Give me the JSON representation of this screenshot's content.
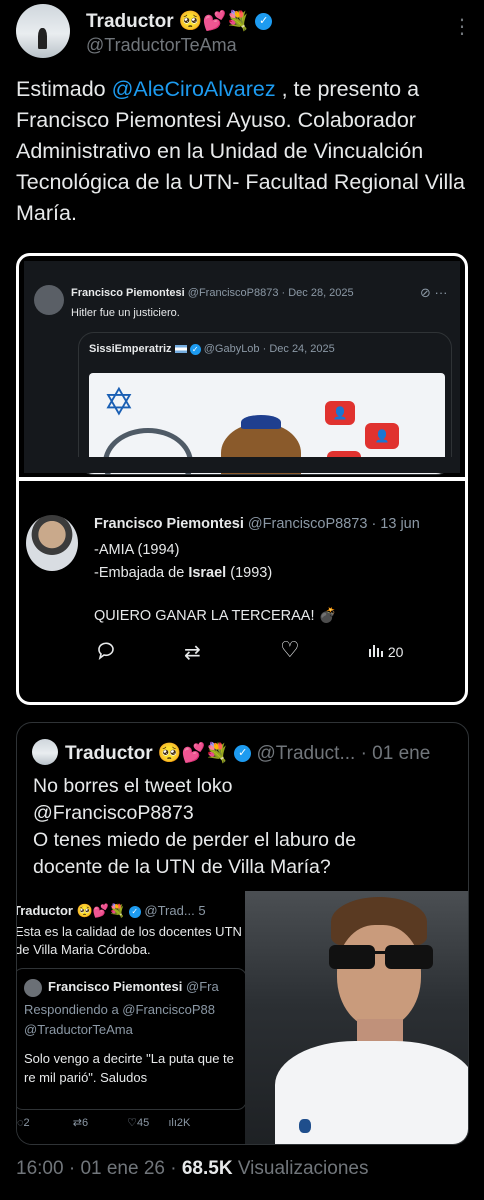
{
  "header": {
    "name": "Traductor",
    "name_emojis": "🥺💕💐",
    "handle": "@TraductorTeAma",
    "more": "⋮"
  },
  "tweet": {
    "text_pre": "Estimado ",
    "mention": "@AleCiroAlvarez",
    "text_post": " , te presento a Francisco Piemontesi Ayuso. Colaborador Administrativo en la Unidad de Vincualción Tecnológica de la UTN- Facultad Regional Villa María."
  },
  "shot1": {
    "name": "Francisco Piemontesi",
    "handle_date": "@FranciscoP8873 · Dec 28, 2025",
    "text": "Hitler fue un justiciero.",
    "quoted_name": "SissiEmperatriz",
    "quoted_handle_date": "@GabyLob · Dec 24, 2025",
    "star": "✡",
    "badge1": "👤",
    "badge2": "👤"
  },
  "shot2": {
    "name": "Francisco Piemontesi",
    "handle_date": "@FranciscoP8873 · 13 jun",
    "line1": "-AMIA (1994)",
    "line2_pre": "-Embajada de ",
    "line2_bold": "Israel",
    "line2_post": " (1993)",
    "line3": "QUIERO GANAR LA TERCERAA! 💣",
    "reply_icon": "💬",
    "retweet_icon": "⇄",
    "like_icon": "♡",
    "views": "20"
  },
  "quote": {
    "name": "Traductor",
    "name_emojis": "🥺💕💐",
    "handle_date": "@Traduct... · 01 ene",
    "text_lines": [
      "No borres el tweet loko",
      "@FranciscoP8873",
      "O tenes miedo de perder el laburo de",
      "docente de la UTN de Villa María?"
    ]
  },
  "inner": {
    "name": "Traductor",
    "name_emojis": "🥺💕💐",
    "handle": "@Trad...",
    "extra": "5",
    "text": "Esta es la calidad de los docentes UTN de Villa Maria Córdoba.",
    "nested_name": "Francisco Piemontesi",
    "nested_handle": "@Fra",
    "replying": "Respondiendo a @FranciscoP88",
    "replying2": "@TraductorTeAma",
    "nested_text": "Solo vengo a decirte \"La puta que te re mil parió\". Saludos",
    "stats": [
      "2",
      "6",
      "45",
      "2K"
    ]
  },
  "footer": {
    "time": "16:00",
    "date": "01 ene 26",
    "views": "68.5K",
    "views_label": "Visualizaciones"
  }
}
